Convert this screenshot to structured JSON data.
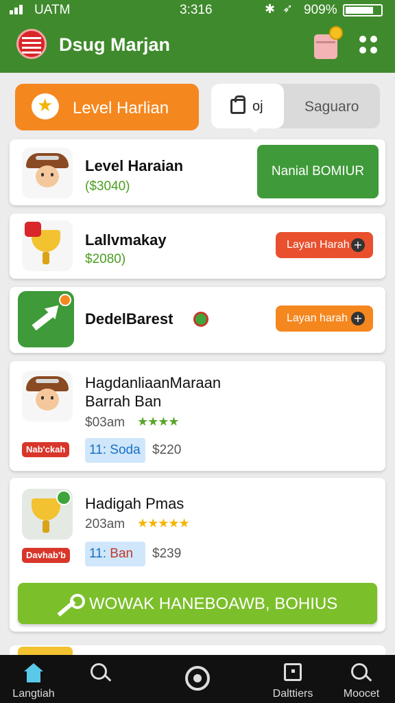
{
  "status_bar": {
    "carrier": "UATM",
    "time": "3:316",
    "battery_pct": "909%",
    "icons": [
      "signal-icon",
      "bluetooth-icon",
      "wifi-icon",
      "battery-icon"
    ]
  },
  "app_bar": {
    "title": "Dsug Marjan",
    "accent_color": "#3f8a2c"
  },
  "tabs": {
    "level_label": "Level Harlian",
    "segment_count": "oj",
    "segment_right": "Saguaro"
  },
  "items": [
    {
      "title": "Level Haraian",
      "price": "($3040)",
      "action": "Nanial BOMIUR"
    },
    {
      "title": "Lallvmakay",
      "price": "$2080)",
      "action": "Layan Harah"
    },
    {
      "title": "DedelBarest",
      "action": "Layan harah"
    },
    {
      "title_line1": "HagdanliaanMaraan",
      "title_line2": "Barrah Ban",
      "meta": "$03am",
      "stars": "★★★★",
      "tag": "Nab'ckah",
      "chip_num": "11:",
      "chip_text": "Soda",
      "amount": "$220"
    },
    {
      "title": "Hadigah Pmas",
      "meta": "203am",
      "stars": "★★★★★",
      "tag": "Davhab'b",
      "chip_num": "11:",
      "chip_text": "Ban",
      "amount": "$239"
    }
  ],
  "cta": {
    "label": "WOWAK HANEBOAWB, BOHIUS"
  },
  "nav": [
    {
      "label": "Langtiah",
      "icon": "home-icon"
    },
    {
      "label": "",
      "icon": "search-icon"
    },
    {
      "label": "",
      "icon": "center-icon"
    },
    {
      "label": "Dalttiers",
      "icon": "box-icon"
    },
    {
      "label": "Moocet",
      "icon": "search-icon"
    }
  ]
}
